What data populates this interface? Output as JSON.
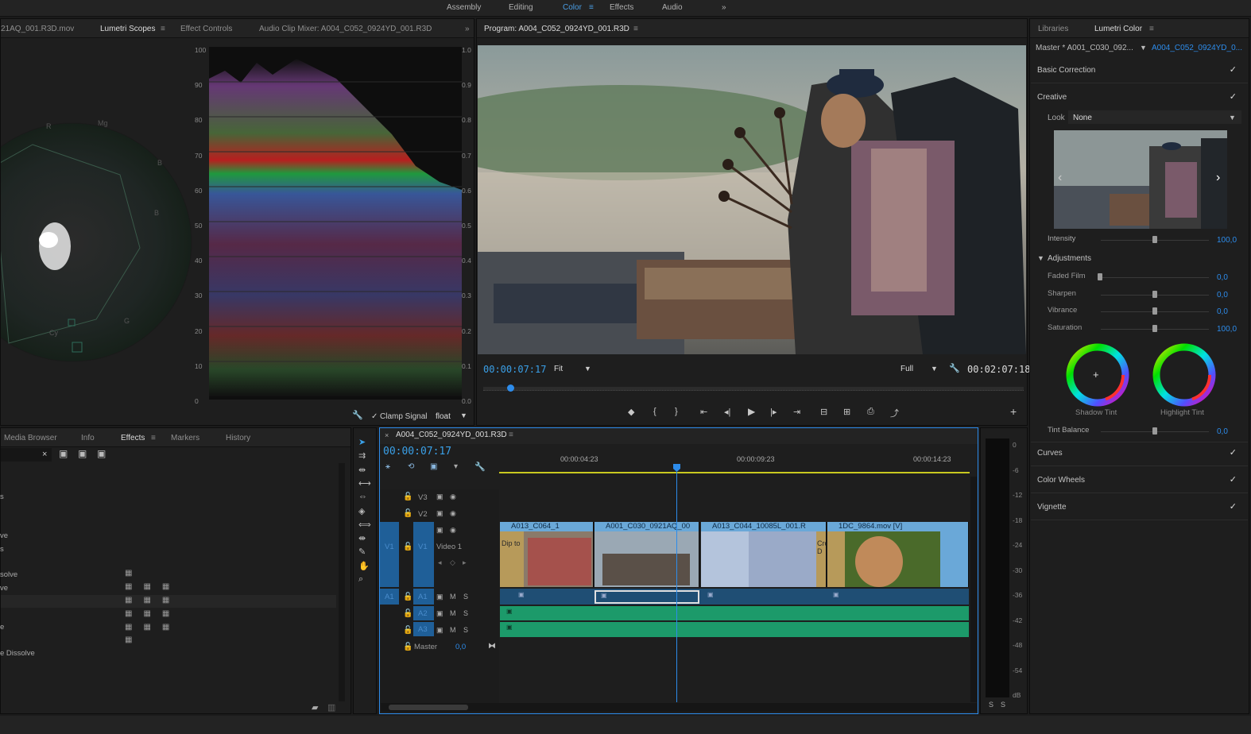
{
  "workspaces": [
    "Assembly",
    "Editing",
    "Color",
    "Effects",
    "Audio"
  ],
  "workspace_active": "Color",
  "workspace_more": "»",
  "source_panel": {
    "tabs": [
      "21AQ_001.R3D.mov",
      "Lumetri Scopes",
      "Effect Controls",
      "Audio Clip Mixer: A004_C052_0924YD_001.R3D"
    ],
    "active_tab": "Lumetri Scopes",
    "more": "»"
  },
  "scopes": {
    "vectorscope_labels": {
      "r": "R",
      "mg": "Mg",
      "b": "B",
      "cy": "Cy",
      "g": "G",
      "yl": "YL"
    },
    "left_ticks": [
      "100",
      "90",
      "80",
      "70",
      "60",
      "50",
      "40",
      "30",
      "20",
      "10",
      "0"
    ],
    "right_ticks": [
      "1.0",
      "0.9",
      "0.8",
      "0.7",
      "0.6",
      "0.5",
      "0.4",
      "0.3",
      "0.2",
      "0.1",
      "0.0"
    ],
    "clamp_label": "Clamp Signal",
    "clamp_check": "✓",
    "precision": "float"
  },
  "program": {
    "title": "Program: A004_C052_0924YD_001.R3D",
    "timecode_current": "00:00:07:17",
    "fit": "Fit",
    "quality": "Full",
    "timecode_total": "00:02:07:18",
    "playhead_fraction": 0.05,
    "transport": [
      "◆",
      "{",
      "}",
      "⇤",
      "◂|",
      "▶",
      "|▸",
      "⇥",
      "⊟",
      "⊞",
      "⎙",
      "⤴"
    ],
    "add": "+"
  },
  "lumetri": {
    "tabs": [
      "Libraries",
      "Lumetri Color"
    ],
    "active_tab": "Lumetri Color",
    "master": "Master * A001_C030_092...",
    "clip_link": "A004_C052_0924YD_0...",
    "basic_correction": "Basic Correction",
    "creative": "Creative",
    "look_label": "Look",
    "look_value": "None",
    "intensity_label": "Intensity",
    "intensity_value": "100,0",
    "intensity_fraction": 1.0,
    "adjustments": "Adjustments",
    "sliders": [
      {
        "label": "Faded Film",
        "value": "0,0",
        "fraction": 0.0
      },
      {
        "label": "Sharpen",
        "value": "0,0",
        "fraction": 0.5
      },
      {
        "label": "Vibrance",
        "value": "0,0",
        "fraction": 0.5
      },
      {
        "label": "Saturation",
        "value": "100,0",
        "fraction": 0.5
      }
    ],
    "shadow_tint": "Shadow Tint",
    "highlight_tint": "Highlight Tint",
    "tint_balance_label": "Tint Balance",
    "tint_balance_value": "0,0",
    "tint_balance_fraction": 0.5,
    "curves": "Curves",
    "color_wheels": "Color Wheels",
    "vignette": "Vignette",
    "check": "✓"
  },
  "effects_panel": {
    "tabs": [
      "Media Browser",
      "Info",
      "Effects",
      "Markers",
      "History"
    ],
    "active_tab": "Effects",
    "items": [
      "s",
      "",
      "ve",
      "s",
      "",
      "solve",
      "ve",
      "",
      "",
      "e",
      "",
      "e Dissolve"
    ]
  },
  "timeline": {
    "title": "A004_C052_0924YD_001.R3D",
    "timecode": "00:00:07:17",
    "ruler": [
      "00:00:04:23",
      "00:00:09:23",
      "00:00:14:23"
    ],
    "tracks": {
      "v3": "V3",
      "v2": "V2",
      "v1": "V1",
      "video1": "Video 1",
      "a1": "A1",
      "a2": "A2",
      "a3": "A3",
      "master": "Master",
      "master_val": "0,0"
    },
    "clips": [
      {
        "title": "A013_C064_1",
        "label": "Dip to"
      },
      {
        "title": "A001_C030_0921AQ_00",
        "label": ""
      },
      {
        "title": "A013_C044_10085L_001.R",
        "label": "Cross D"
      },
      {
        "title": "1DC_9864.mov [V]",
        "label": ""
      }
    ],
    "audio_meter_ticks": [
      "0",
      "-6",
      "-12",
      "-18",
      "-24",
      "-30",
      "-36",
      "-42",
      "-48",
      "-54",
      "dB"
    ],
    "meter_solo": [
      "S",
      "S"
    ],
    "ms": {
      "m": "M",
      "s": "S"
    }
  }
}
